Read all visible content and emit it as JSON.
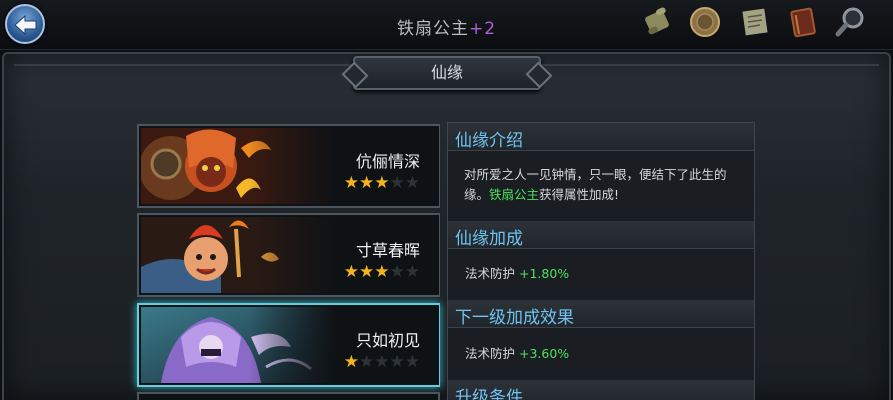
{
  "header": {
    "title": "铁扇公主",
    "title_suffix": "+2",
    "icons": [
      "scroll-icon",
      "medal-icon",
      "map-icon",
      "book-icon",
      "magnifier-icon"
    ]
  },
  "section": {
    "title": "仙缘"
  },
  "cards": [
    {
      "name": "伉俪情深",
      "stars": 3,
      "max_stars": 5,
      "selected": false
    },
    {
      "name": "寸草春晖",
      "stars": 3,
      "max_stars": 5,
      "selected": false
    },
    {
      "name": "只如初见",
      "stars": 1,
      "max_stars": 5,
      "selected": true
    }
  ],
  "info": {
    "intro_title": "仙缘介绍",
    "intro_text_1": "对所爱之人一见钟情，只一眼，便结下了此生的缘。",
    "intro_highlight": "铁扇公主",
    "intro_text_2": "获得属性加成!",
    "bonus_title": "仙缘加成",
    "bonus_label": "法术防护",
    "bonus_value": "+1.80%",
    "next_title": "下一级加成效果",
    "next_label": "法术防护",
    "next_value": "+3.60%",
    "upgrade_title": "升级条件"
  },
  "colors": {
    "accent_blue": "#6fc3ee",
    "green_value": "#4fe05c",
    "title_plus": "#b05ee0",
    "star": "#f2b51c",
    "selected_border": "#5fd0e0"
  }
}
